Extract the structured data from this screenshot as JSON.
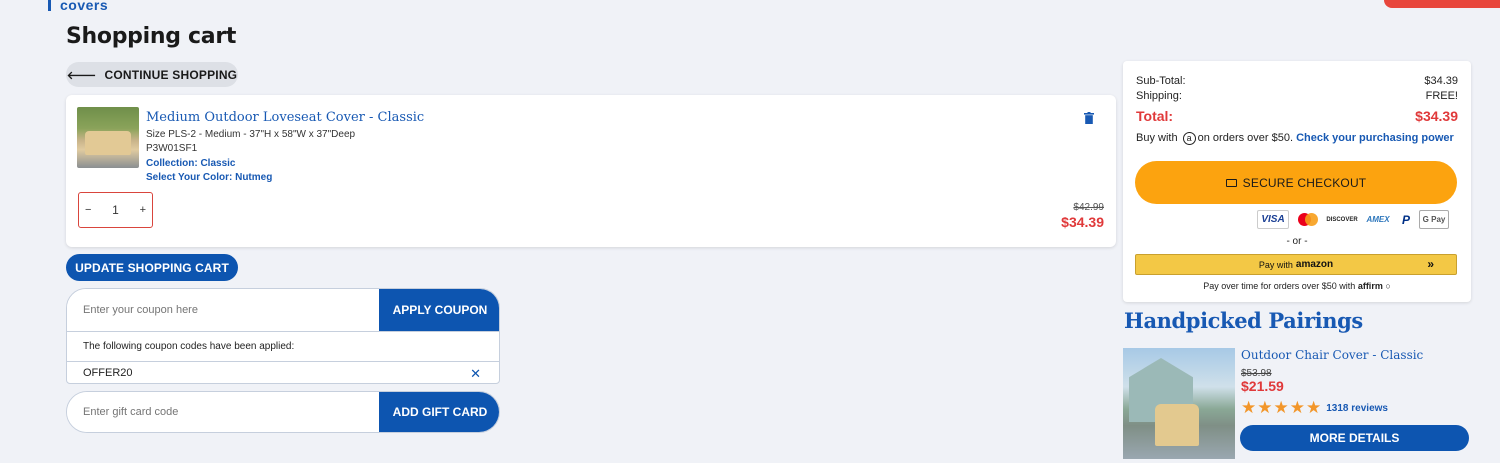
{
  "header": {
    "logo_text": "covers"
  },
  "page": {
    "title": "Shopping cart"
  },
  "actions": {
    "continue_shopping": "CONTINUE SHOPPING",
    "update_cart": "UPDATE SHOPPING CART"
  },
  "cart_item": {
    "title": "Medium Outdoor Loveseat Cover - Classic",
    "size": "Size PLS-2 - Medium - 37\"H x 58\"W x 37\"Deep",
    "sku": "P3W01SF1",
    "collection": "Collection: Classic",
    "color": "Select Your Color: Nutmeg",
    "quantity": "1",
    "qty_minus": "−",
    "qty_plus": "+",
    "price_old": "$42.99",
    "price_new": "$34.39",
    "delete_icon": "trash-icon"
  },
  "coupon": {
    "placeholder": "Enter your coupon here",
    "button": "APPLY COUPON",
    "applied_note": "The following coupon codes have been applied:",
    "applied_code": "OFFER20",
    "remove_symbol": "✕"
  },
  "gift_card": {
    "placeholder": "Enter gift card code",
    "button": "ADD GIFT CARD"
  },
  "summary": {
    "subtotal_label": "Sub-Total:",
    "subtotal_value": "$34.39",
    "shipping_label": "Shipping:",
    "shipping_value": "FREE!",
    "total_label": "Total:",
    "total_value": "$34.39",
    "affirm_prefix": "Buy with",
    "affirm_icon": "a",
    "affirm_suffix": "on orders over $50.",
    "affirm_link": "Check your purchasing power",
    "checkout_button": "SECURE CHECKOUT",
    "payment_logos": {
      "visa": "VISA",
      "discover": "DISCOVER",
      "amex": "AMEX",
      "paypal": "P",
      "gpay": "G Pay"
    },
    "or_text": "- or -",
    "amazon_prefix": "Pay with",
    "amazon_brand": "amazon",
    "amazon_chevron": "»",
    "affirm_bottom_prefix": "Pay over time for orders over $50 with",
    "affirm_bottom_brand": "affirm",
    "affirm_bottom_info": "○"
  },
  "pairings": {
    "title": "Handpicked Pairings",
    "items": [
      {
        "name": "Outdoor Chair Cover - Classic",
        "price_old": "$53.98",
        "price_new": "$21.59",
        "rating": 4.5,
        "stars": [
          "★",
          "★",
          "★",
          "★",
          "★"
        ],
        "reviews": "1318 reviews",
        "button": "MORE DETAILS"
      }
    ]
  },
  "colors": {
    "brand_blue": "#0d55b0",
    "link_blue": "#1859b3",
    "sale_red": "#e0393a",
    "checkout_orange": "#fca30f",
    "star_orange": "#f2962a"
  }
}
